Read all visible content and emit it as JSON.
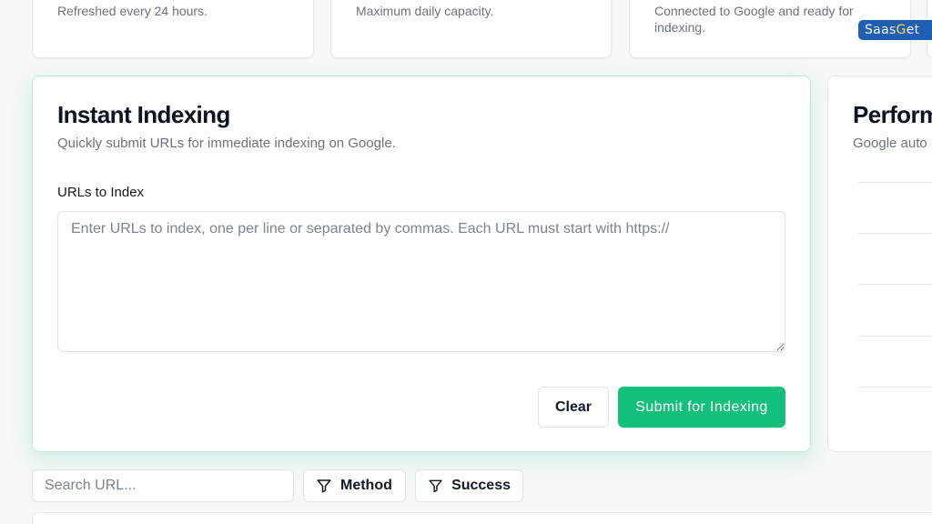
{
  "stat_cards": [
    {
      "desc": "Refreshed every 24 hours."
    },
    {
      "desc": "Maximum daily capacity."
    },
    {
      "desc": "Connected to Google and ready for indexing."
    }
  ],
  "watermark": {
    "prefix": "Saas",
    "g": "G",
    "suffix": "et"
  },
  "instant_indexing": {
    "title": "Instant Indexing",
    "subtitle": "Quickly submit URLs for immediate indexing on Google.",
    "field_label": "URLs to Index",
    "placeholder": "Enter URLs to index, one per line or separated by commas. Each URL must start with https://",
    "value": "",
    "clear_label": "Clear",
    "submit_label": "Submit for Indexing"
  },
  "performance": {
    "title": "Perform",
    "subtitle": "Google auto"
  },
  "filters": {
    "search_placeholder": "Search URL...",
    "method_label": "Method",
    "success_label": "Success"
  },
  "colors": {
    "accent": "#12c07a",
    "panel_border": "#b4ecd4",
    "watermark_bg": "#1e5fb3"
  },
  "icons": {
    "filter": "filter-icon",
    "resize": "resize-handle-icon"
  }
}
